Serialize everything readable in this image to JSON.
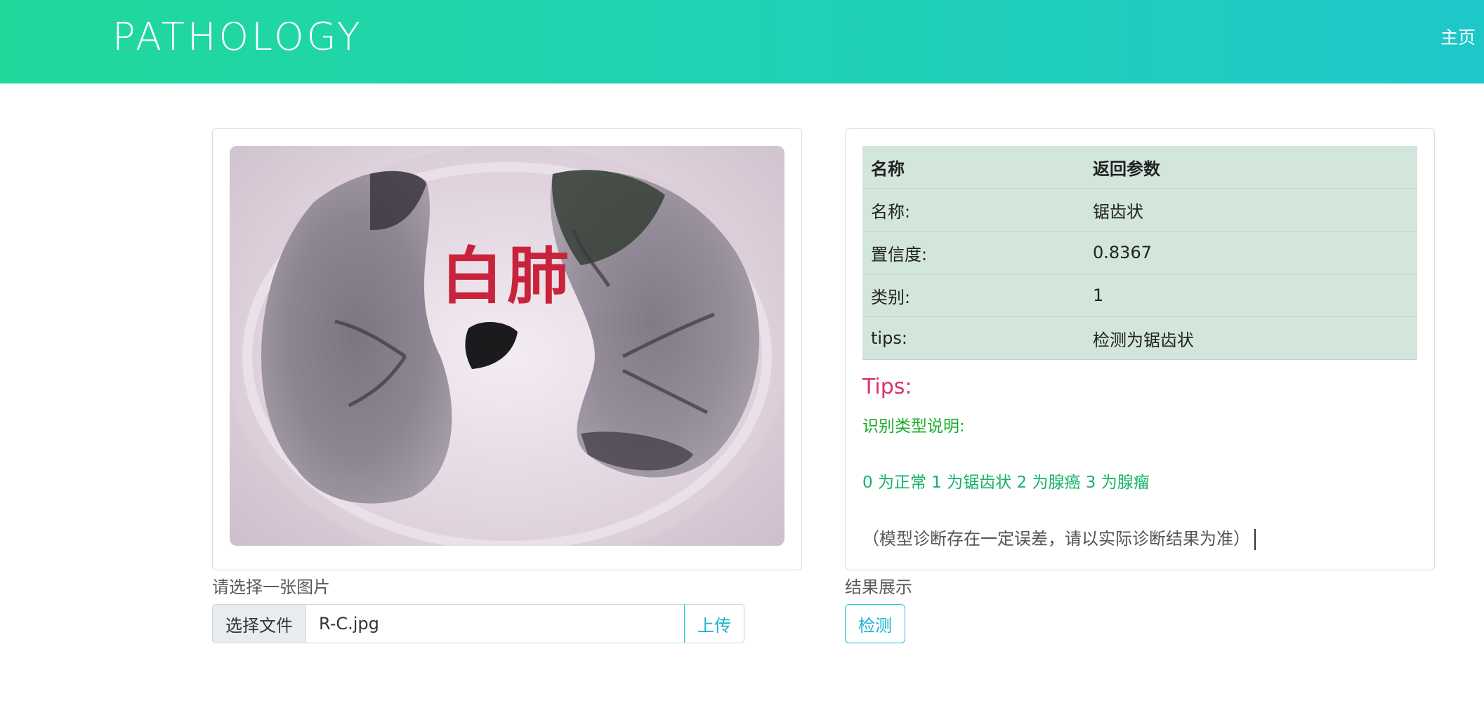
{
  "header": {
    "brand": "PATHOLOGY",
    "nav_home": "主页"
  },
  "left_panel": {
    "image_overlay_text": "白肺",
    "select_label": "请选择一张图片",
    "choose_file_label": "选择文件",
    "file_name": "R-C.jpg",
    "upload_label": "上传"
  },
  "right_panel": {
    "table_headers": [
      "名称",
      "返回参数"
    ],
    "rows": [
      {
        "key": "名称:",
        "value": "锯齿状"
      },
      {
        "key": "置信度:",
        "value": "0.8367"
      },
      {
        "key": "类别:",
        "value": "1"
      },
      {
        "key": "tips:",
        "value": "检测为锯齿状"
      }
    ],
    "tips_title": "Tips:",
    "tips_subtitle": "识别类型说明:",
    "tips_classes": "0 为正常 1 为锯齿状 2 为腺癌 3 为腺瘤",
    "tips_note": "（模型诊断存在一定误差，请以实际诊断结果为准）",
    "result_label": "结果展示",
    "detect_label": "检测"
  },
  "colors": {
    "header_gradient_start": "#20d89c",
    "header_gradient_end": "#1ec8c9",
    "table_bg": "#d2e6dc",
    "tips_title": "#d6336c",
    "tips_subtitle": "#1aad2b",
    "accent": "#17b3cf"
  }
}
